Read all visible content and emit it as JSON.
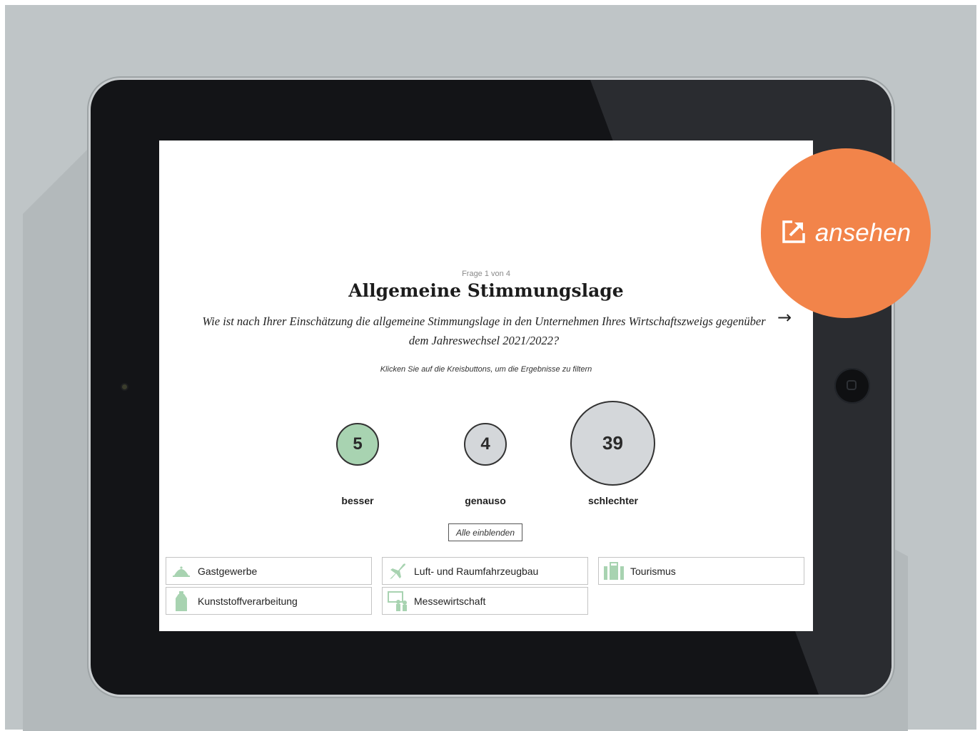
{
  "survey": {
    "question_counter": "Frage 1 von 4",
    "title": "Allgemeine Stimmungslage",
    "question": "Wie ist nach Ihrer Einschätzung die allgemeine Stimmungslage in den Unternehmen Ihres Wirtschaftszweigs gegenüber dem Jahreswechsel 2021/2022?",
    "next_arrow": "→",
    "hint": "Klicken Sie auf die Kreisbuttons, um die Ergebnisse zu filtern",
    "answers": [
      {
        "count": "5",
        "label": "besser",
        "color": "#a8d3b1"
      },
      {
        "count": "4",
        "label": "genauso",
        "color": "#d4d7da"
      },
      {
        "count": "39",
        "label": "schlechter",
        "color": "#d4d7da"
      }
    ],
    "show_all": "Alle einblenden",
    "industries": [
      {
        "label": "Gastgewerbe",
        "icon": "cloche-icon"
      },
      {
        "label": "Luft- und Raumfahrzeugbau",
        "icon": "airplane-icon"
      },
      {
        "label": "Tourismus",
        "icon": "suitcase-icon"
      },
      {
        "label": "Kunststoffverarbeitung",
        "icon": "bottle-icon"
      },
      {
        "label": "Messewirtschaft",
        "icon": "exhibition-icon"
      }
    ],
    "icon_color": "#a8d3b1"
  },
  "badge": {
    "label": "ansehen",
    "icon": "external-link-icon",
    "color": "#f2844a"
  }
}
